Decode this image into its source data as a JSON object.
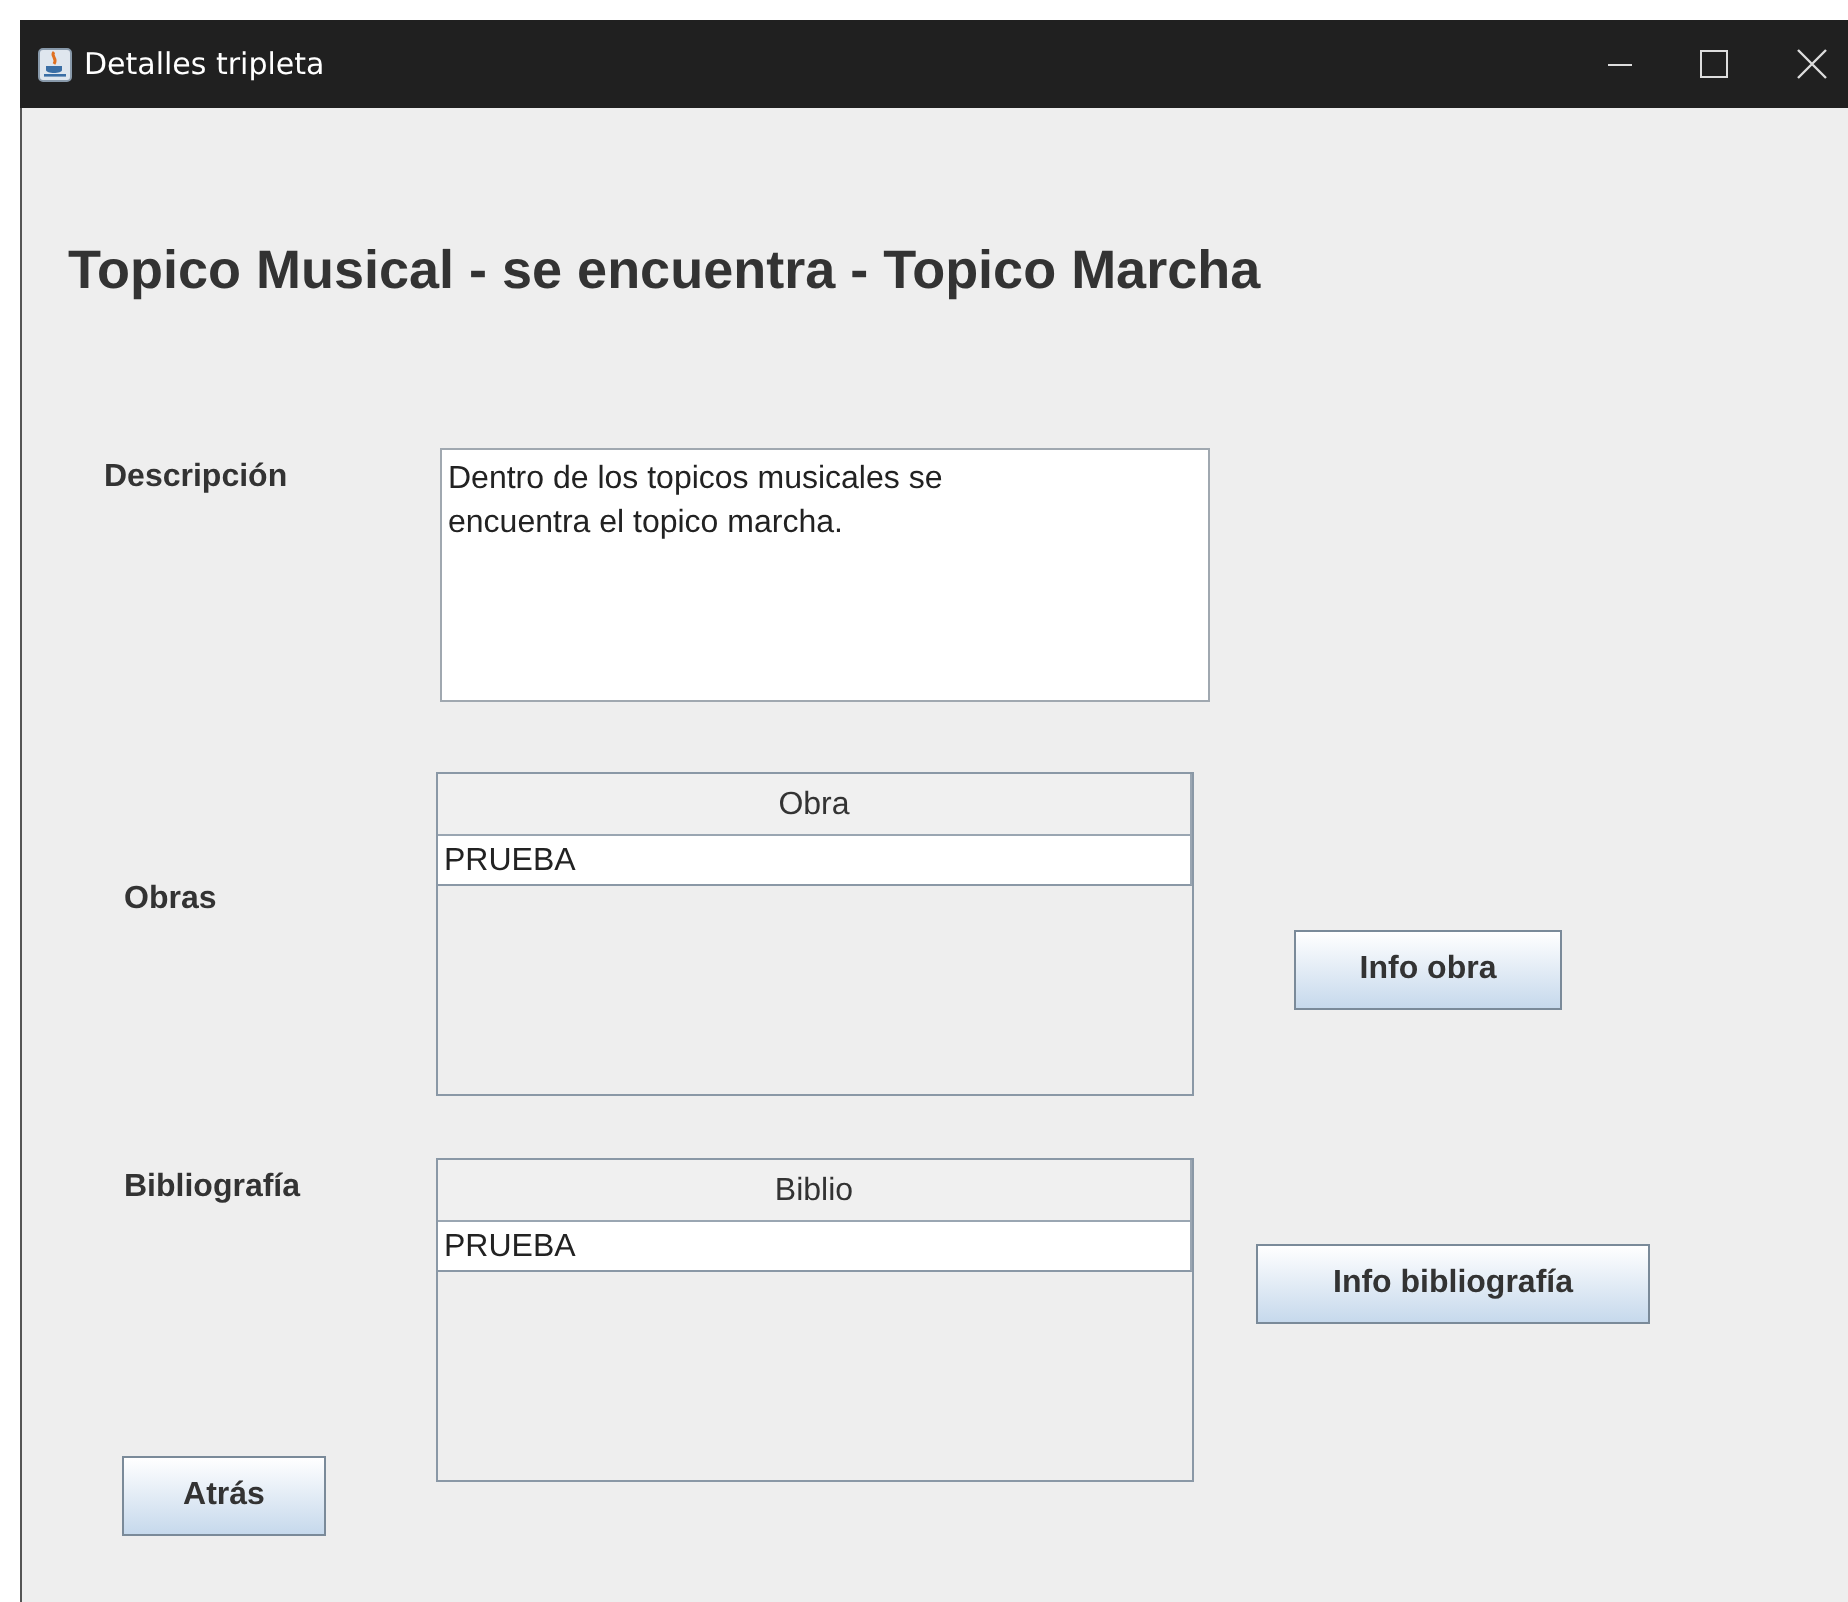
{
  "window": {
    "title": "Detalles tripleta"
  },
  "heading": "Topico Musical - se encuentra - Topico Marcha",
  "description": {
    "label": "Descripción",
    "value": "Dentro de los topicos musicales se encuentra el topico marcha."
  },
  "tables": [
    {
      "label": "Obras",
      "columns": [
        "Obra"
      ],
      "rows": [
        "PRUEBA"
      ],
      "button": "Info obra"
    },
    {
      "label": "Bibliografía",
      "columns": [
        "Biblio"
      ],
      "rows": [
        "PRUEBA"
      ],
      "button": "Info bibliografía"
    }
  ],
  "back_button": "Atrás"
}
